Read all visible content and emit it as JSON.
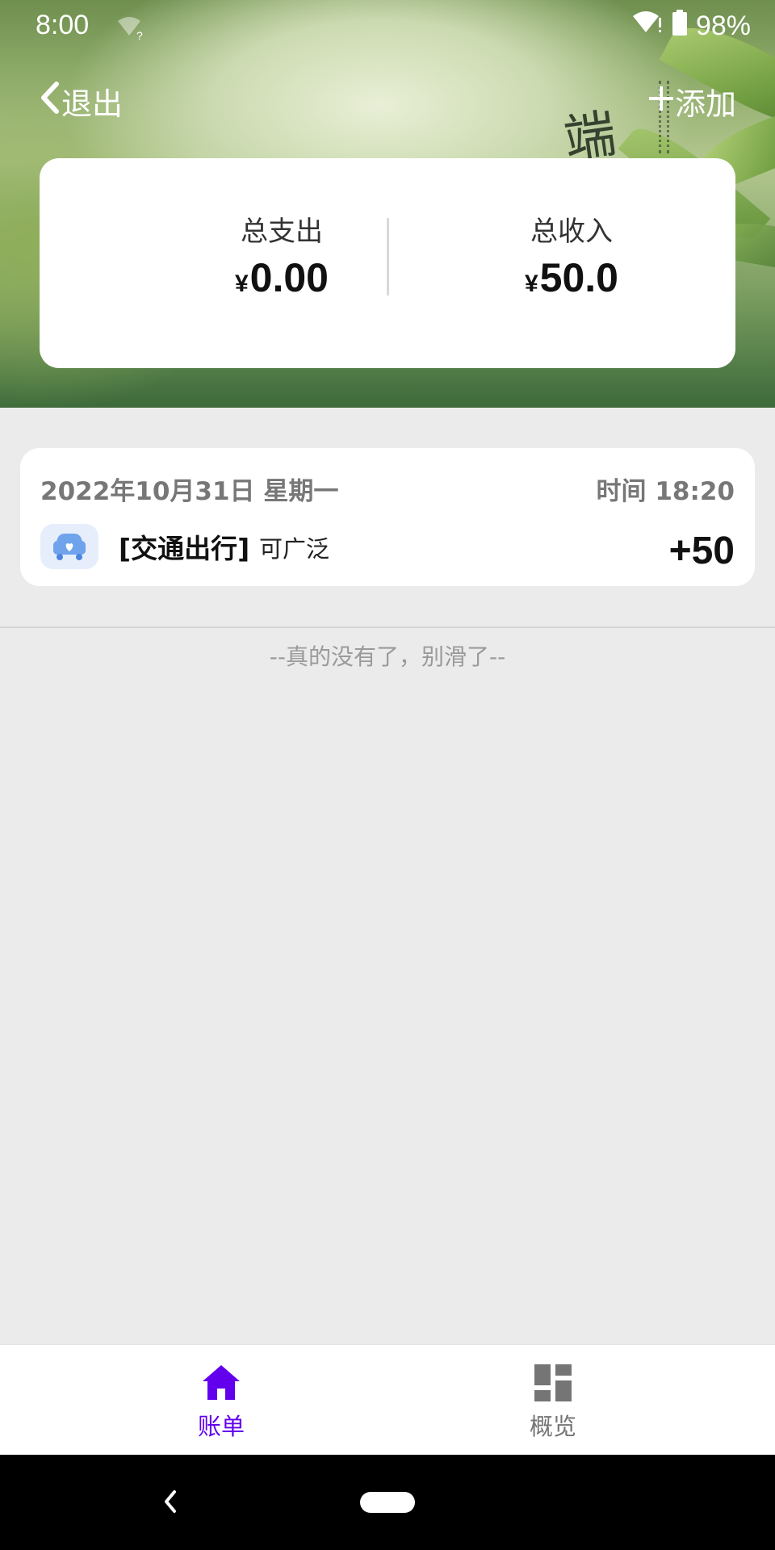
{
  "status_bar": {
    "time": "8:00",
    "battery": "98%",
    "icons": [
      "wifi-question-icon",
      "wifi-alert-icon",
      "battery-icon"
    ]
  },
  "app_bar": {
    "back_label": "退出",
    "add_label": "添加",
    "back_icon": "chevron-left-icon",
    "add_icon": "plus-icon"
  },
  "summary": {
    "expense_label": "总支出",
    "expense_currency": "¥",
    "expense_value": "0.00",
    "income_label": "总收入",
    "income_currency": "¥",
    "income_value": "50.0"
  },
  "records": [
    {
      "date": "2022年10月31日 星期一",
      "time": "时间 18:20",
      "category": "[交通出行]",
      "note": "可广泛",
      "amount": "+50",
      "icon": "car-icon"
    }
  ],
  "list_end_text": "--真的没有了，别滑了--",
  "bottom_nav": {
    "items": [
      {
        "label": "账单",
        "icon": "home-icon",
        "active": true,
        "color": "#6200ee"
      },
      {
        "label": "概览",
        "icon": "dashboard-icon",
        "active": false,
        "color": "#757575"
      }
    ]
  },
  "system_nav": {
    "icons": [
      "back-icon",
      "home-pill-icon"
    ]
  },
  "banner": {
    "calligraphy": "端"
  }
}
